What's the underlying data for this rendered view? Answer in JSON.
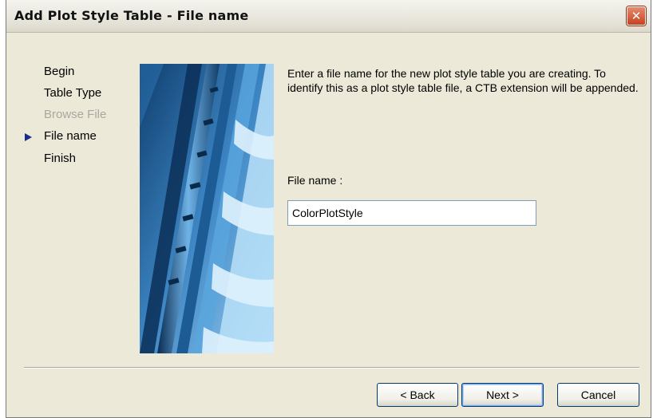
{
  "window": {
    "title": "Add Plot Style Table - File name",
    "close_glyph": "✕"
  },
  "nav": {
    "items": [
      {
        "label": "Begin",
        "state": "normal"
      },
      {
        "label": "Table Type",
        "state": "normal"
      },
      {
        "label": "Browse File",
        "state": "disabled"
      },
      {
        "label": "File name",
        "state": "current"
      },
      {
        "label": "Finish",
        "state": "normal"
      }
    ]
  },
  "main": {
    "description": "Enter a file name for the new plot style table you are creating. To identify this as a plot style table file, a CTB extension will be appended.",
    "file_name_label": "File name :",
    "file_name_value": "ColorPlotStyle"
  },
  "buttons": {
    "back": "< Back",
    "next": "Next >",
    "cancel": "Cancel"
  },
  "colors": {
    "arrow": "#1a2b8c",
    "close": "#c4421f",
    "art": "#1e5a92"
  },
  "icons": {
    "close": "close-icon",
    "current_step": "current-step-arrow-icon"
  }
}
